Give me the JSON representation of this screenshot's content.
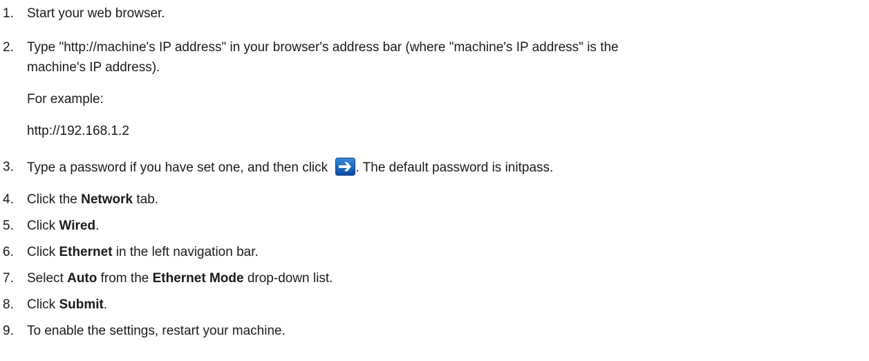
{
  "steps": [
    {
      "num": "1.",
      "text": "Start your web browser."
    },
    {
      "num": "2.",
      "line1": "Type \"http://machine's IP address\" in your browser's address bar (where \"machine's IP address\" is the",
      "line2": "machine's IP address).",
      "example_label": "For example:",
      "example_url": "http://192.168.1.2"
    },
    {
      "num": "3.",
      "pre": "Type a password if you have set one, and then click ",
      "post": ". The default password is initpass.",
      "icon": "arrow-right-icon"
    },
    {
      "num": "4.",
      "pre": "Click the ",
      "bold": "Network",
      "post": " tab."
    },
    {
      "num": "5.",
      "pre": "Click ",
      "bold": "Wired",
      "post": "."
    },
    {
      "num": "6.",
      "pre": "Click ",
      "bold": "Ethernet",
      "post": " in the left navigation bar."
    },
    {
      "num": "7.",
      "pre": "Select ",
      "bold": "Auto",
      "mid": " from the ",
      "bold2": "Ethernet Mode",
      "post": " drop-down list."
    },
    {
      "num": "8.",
      "pre": "Click ",
      "bold": "Submit",
      "post": "."
    },
    {
      "num": "9.",
      "text": "To enable the settings, restart your machine."
    }
  ],
  "colors": {
    "text": "#1a1a1a",
    "button_top": "#2f7fd0",
    "button_bottom": "#0d4d9e"
  }
}
